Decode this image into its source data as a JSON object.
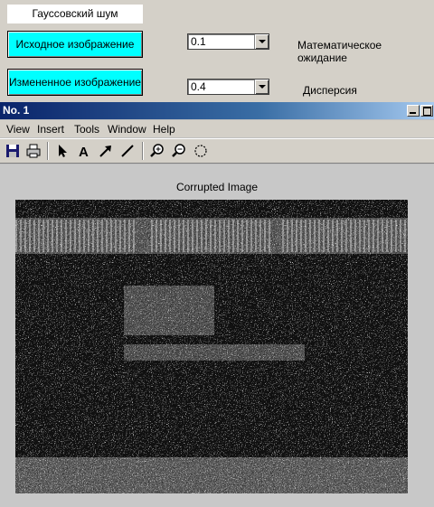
{
  "panel": {
    "title": "Гауссовский шум",
    "btn_original": "Исходное изображение",
    "btn_modified": "Измененное изображение",
    "mean_value": "0.1",
    "mean_label": "Математическое ожидание",
    "variance_value": "0.4",
    "variance_label": "Дисперсия"
  },
  "figure": {
    "window_title": "No. 1",
    "menu": [
      "View",
      "Insert",
      "Tools",
      "Window",
      "Help"
    ],
    "toolbar_icons": [
      "save-icon",
      "print-icon",
      "arrow-pointer-icon",
      "text-icon",
      "arrow-line-icon",
      "line-icon",
      "zoom-in-icon",
      "zoom-out-icon",
      "rotate-icon"
    ],
    "plot_title": "Corrupted Image"
  },
  "colors": {
    "button_bg": "#00ffff",
    "titlebar_start": "#0a246a",
    "titlebar_end": "#a6caf0"
  }
}
